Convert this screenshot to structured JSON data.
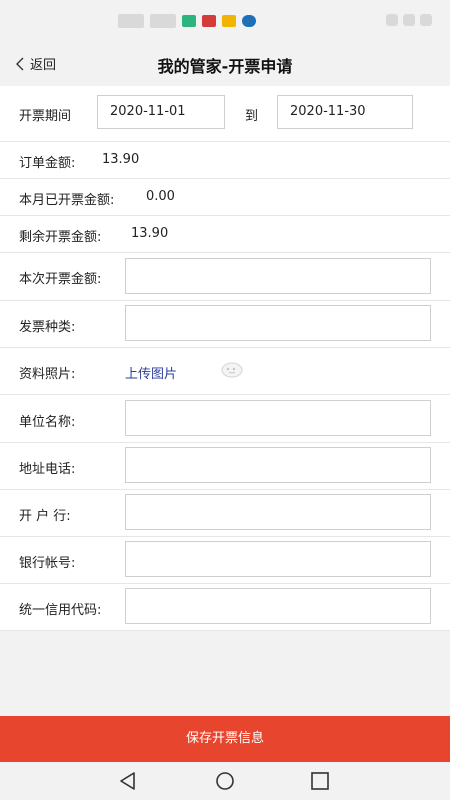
{
  "header": {
    "back_label": "返回",
    "title": "我的管家-开票申请"
  },
  "period": {
    "label": "开票期间",
    "start": "2020-11-01",
    "to_label": "到",
    "end": "2020-11-30"
  },
  "summary": {
    "order_amount_label": "订单金额:",
    "order_amount": "13.90",
    "invoiced_label": "本月已开票金额:",
    "invoiced": "0.00",
    "remaining_label": "剩余开票金额:",
    "remaining": "13.90"
  },
  "fields": {
    "current_amount_label": "本次开票金额:",
    "current_amount_value": "",
    "invoice_type_label": "发票种类:",
    "invoice_type_value": "",
    "photo_label": "资料照片:",
    "upload_label": "上传图片",
    "company_label": "单位名称:",
    "company_value": "",
    "address_label": "地址电话:",
    "address_value": "",
    "bank_label": "开 户 行:",
    "bank_value": "",
    "account_label": "银行帐号:",
    "account_value": "",
    "credit_code_label": "统一信用代码:",
    "credit_code_value": ""
  },
  "footer": {
    "save_label": "保存开票信息"
  },
  "colors": {
    "accent": "#e8452e",
    "link": "#2e3e9c",
    "background": "#f2f2f2"
  },
  "icons": {
    "back": "chevron-left-icon",
    "photo": "image-placeholder-icon",
    "sys_back": "triangle-back-icon",
    "sys_home": "circle-home-icon",
    "sys_recent": "square-recent-icon"
  }
}
